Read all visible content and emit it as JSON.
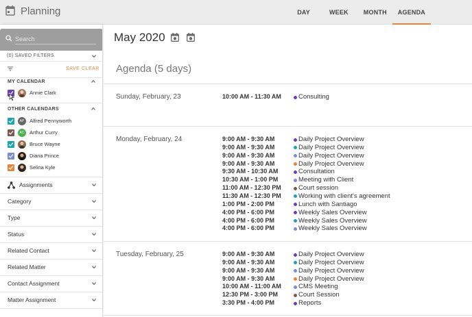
{
  "app": {
    "title": "Planning",
    "icon": "calendar-icon"
  },
  "views": [
    "DAY",
    "WEEK",
    "MONTH",
    "AGENDA"
  ],
  "active_view": "AGENDA",
  "colors": {
    "accent": "#e8843a",
    "purple": "#6a3fb5",
    "teal": "#1ba5b2",
    "orange": "#e8843a",
    "blue_gray": "#7b8bd6",
    "brown": "#7a5a4a",
    "green": "#4caf50"
  },
  "sidebar": {
    "search_placeholder": "Search",
    "saved_filters": "(0) SAVED FILTERS",
    "save_label": "SAVE",
    "clear_label": "CLEAR",
    "my_calendar_title": "MY CALENDAR",
    "my_calendars": [
      {
        "name": "Annie Clark",
        "color": "#6a3fb5",
        "checked": true,
        "avatar": "photo"
      }
    ],
    "other_calendars_title": "OTHER CALENDARS",
    "other_calendars": [
      {
        "name": "Alfred Pennyworth",
        "color": "#1ba5b2",
        "checked": true,
        "avatar_initials": "AP",
        "avatar_color": "#666"
      },
      {
        "name": "Arthur Curry",
        "color": "#7a5a4a",
        "checked": true,
        "avatar_initials": "AC",
        "avatar_color": "#4caf50"
      },
      {
        "name": "Bruce Wayne",
        "color": "#1ba5b2",
        "checked": true,
        "avatar": "photo"
      },
      {
        "name": "Diana Prince",
        "color": "#7b8bd6",
        "checked": true,
        "avatar": "photo"
      },
      {
        "name": "Selina Kyle",
        "color": "#e8843a",
        "checked": true,
        "avatar": "photo"
      }
    ],
    "filters": [
      "Assignments",
      "Category",
      "Type",
      "Status",
      "Related Contact",
      "Related Matter",
      "Contact Assignment",
      "Matter Assignment"
    ]
  },
  "main": {
    "month_title": "May 2020",
    "agenda_title": "Agenda (5 days)",
    "days": [
      {
        "label": "Sunday, February, 23",
        "events": [
          {
            "time": "10:00 AM - 11:30 AM",
            "title": "Consulting",
            "color": "#6a3fb5"
          }
        ]
      },
      {
        "label": "Monday, February, 24",
        "events": [
          {
            "time": "9:00 AM - 9:30 AM",
            "title": "Daily Project Overview",
            "color": "#6a3fb5"
          },
          {
            "time": "9:00 AM - 9:30 AM",
            "title": "Daily Project Overview",
            "color": "#1ba5b2"
          },
          {
            "time": "9:00 AM - 9:30 AM",
            "title": "Daily Project Overview",
            "color": "#7b8bd6"
          },
          {
            "time": "9:00 AM - 9:30 AM",
            "title": "Daily Project Overview",
            "color": "#e8843a"
          },
          {
            "time": "9:30 AM - 10:30 AM",
            "title": "Consultation",
            "color": "#6a3fb5"
          },
          {
            "time": "10:30 AM - 1:00 PM",
            "title": "Meeting with Client",
            "color": "#7b8bd6"
          },
          {
            "time": "11:00 AM - 12:30 PM",
            "title": "Court session",
            "color": "#7a5a4a"
          },
          {
            "time": "11:30 AM - 12:30 PM",
            "title": "Working with client's agreement",
            "color": "#1ba5b2"
          },
          {
            "time": "1:00 PM - 2:00 PM",
            "title": "Lunch with Santiago",
            "color": "#6a3fb5"
          },
          {
            "time": "4:00 PM - 6:00 PM",
            "title": "Weekly Sales Overview",
            "color": "#6a3fb5"
          },
          {
            "time": "4:00 PM - 6:00 PM",
            "title": "Weekly Sales Overview",
            "color": "#1ba5b2"
          },
          {
            "time": "4:00 PM - 6:00 PM",
            "title": "Weekly Sales Overview",
            "color": "#7b8bd6"
          }
        ]
      },
      {
        "label": "Tuesday, February, 25",
        "events": [
          {
            "time": "9:00 AM - 9:30 AM",
            "title": "Daily Project Overview",
            "color": "#6a3fb5"
          },
          {
            "time": "9:00 AM - 9:30 AM",
            "title": "Daily Project Overview",
            "color": "#1ba5b2"
          },
          {
            "time": "9:00 AM - 9:30 AM",
            "title": "Daily Project Overview",
            "color": "#7b8bd6"
          },
          {
            "time": "9:00 AM - 9:30 AM",
            "title": "Daily Project Overview",
            "color": "#e8843a"
          },
          {
            "time": "10:00 AM - 11:00 AM",
            "title": "CMS Meeting",
            "color": "#7b8bd6"
          },
          {
            "time": "12:30 PM - 3:00 PM",
            "title": "Court Session",
            "color": "#7a5a4a"
          },
          {
            "time": "3:30 PM - 4:00 PM",
            "title": "Reports",
            "color": "#6a3fb5"
          }
        ]
      }
    ]
  }
}
